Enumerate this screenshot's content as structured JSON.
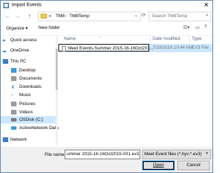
{
  "window": {
    "title": "Import Events",
    "close_glyph": "✕"
  },
  "address": {
    "back_glyph": "←",
    "forward_glyph": "→",
    "up_glyph": "↑",
    "overflow": "«",
    "crumbs": [
      "TM8",
      "TM8Temp"
    ],
    "separator": "›",
    "search_placeholder": "Search TM8Temp"
  },
  "toolbar": {
    "organize": "Organize ▾",
    "new_folder": "New folder"
  },
  "nav_items": [
    {
      "label": "Quick access",
      "icon": "star-icon",
      "color": "#2a84d6"
    },
    {
      "label": "OneDrive",
      "icon": "cloud-icon",
      "color": "#2a84d6"
    },
    {
      "label": "This PC",
      "icon": "computer-icon",
      "color": "#3b7fc4"
    },
    {
      "label": "Desktop",
      "icon": "desktop-icon",
      "color": "#3b9be0"
    },
    {
      "label": "Documents",
      "icon": "documents-icon",
      "color": "#9a9a9a"
    },
    {
      "label": "Downloads",
      "icon": "downloads-icon",
      "color": "#2a84d6"
    },
    {
      "label": "Music",
      "icon": "music-icon",
      "color": "#2a84d6"
    },
    {
      "label": "Pictures",
      "icon": "pictures-icon",
      "color": "#9a9a9a"
    },
    {
      "label": "Videos",
      "icon": "videos-icon",
      "color": "#9a9a9a"
    },
    {
      "label": "OSDisk (C:)",
      "icon": "drive-icon",
      "color": "#7a7a7a"
    },
    {
      "label": "ActiveNetwork Data",
      "icon": "network-drive-icon",
      "color": "#3b9be0"
    },
    {
      "label": "Network",
      "icon": "network-icon",
      "color": "#3b7fc4"
    }
  ],
  "columns": {
    "name": "Name",
    "date": "Date modified",
    "type": "Type"
  },
  "files": [
    {
      "name": "Meet Events-Summer 2015-16-16Oct201...",
      "date": "7/19/2016 10:44 AM",
      "type": "EV3 File"
    }
  ],
  "bottom": {
    "file_name_label": "File name:",
    "file_name_value": "ummer 2015-16-16Oct2015-001.ev3",
    "file_type": "Meet Event files (*.hyv;*.ev3)",
    "open": "Open",
    "cancel": "Cancel"
  }
}
